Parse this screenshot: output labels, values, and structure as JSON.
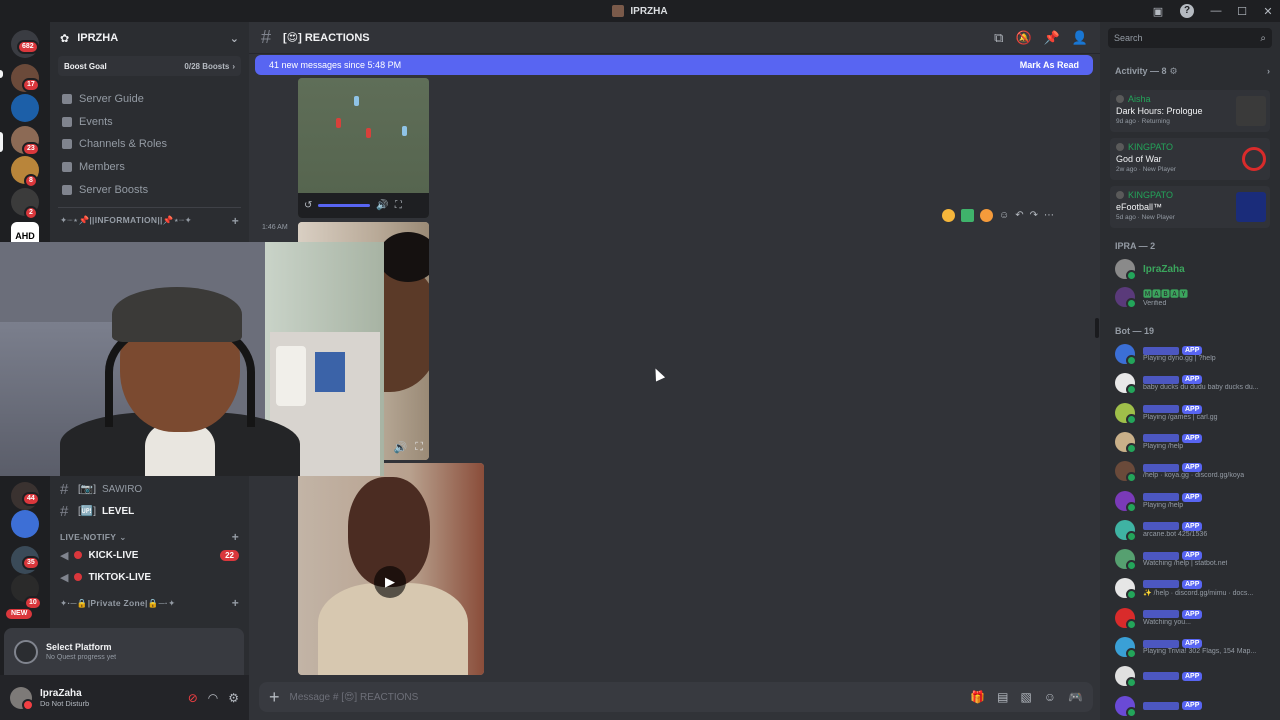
{
  "window": {
    "title": "IPRZHA"
  },
  "rail": {
    "home_badge": "682",
    "badges": [
      "17",
      "23",
      "8",
      "2",
      "44",
      "35",
      "10"
    ],
    "new_label": "NEW",
    "ahd_label": "AHD"
  },
  "server": {
    "name": "IPRZHA",
    "boost_goal": "Boost Goal",
    "boost_count": "0/28 Boosts",
    "nav": [
      "Server Guide",
      "Events",
      "Channels & Roles",
      "Members",
      "Server Boosts"
    ],
    "info_category": "✦┈⋆📌||INFORMATION||📌⋆┈✦",
    "channels_upper": [
      {
        "tag": "[📷]",
        "name": "SAWIRO"
      },
      {
        "tag": "[🆙]",
        "name": "LEVEL"
      }
    ],
    "live_category": "LIVE-NOTIFY",
    "live_channels": [
      {
        "name": "KICK-LIVE",
        "badge": "22"
      },
      {
        "name": "TIKTOK-LIVE",
        "badge": ""
      }
    ],
    "private_category": "✦·─🔒|Private Zone|🔒─·✦"
  },
  "quest": {
    "title": "Select Platform",
    "subtitle": "No Quest progress yet"
  },
  "user": {
    "name": "IpraZaha",
    "status": "Do Not Disturb"
  },
  "chat": {
    "channel_name": "[😍] REACTIONS",
    "new_messages": "41 new messages since 5:48 PM",
    "mark_read": "Mark As Read",
    "timestamp": "1:46 AM",
    "composer_placeholder": "Message # [😍] REACTIONS"
  },
  "members": {
    "search_placeholder": "Search",
    "activity_header": "Activity — 8",
    "activities": [
      {
        "user": "Aisha",
        "game": "Dark Hours: Prologue",
        "meta": "9d ago · Returning"
      },
      {
        "user": "KINGPATO",
        "game": "God of War",
        "meta": "2w ago · New Player"
      },
      {
        "user": "KINGPATO",
        "game": "eFootball™",
        "meta": "5d ago · New Player"
      }
    ],
    "ipra_header": "IPRA — 2",
    "ipra": [
      {
        "name": "IpraZaha",
        "sub": ""
      },
      {
        "name": "🅼🅰🅱🅰🆈",
        "sub": "Verified"
      }
    ],
    "bot_header": "Bot — 19",
    "app_label": "APP",
    "bots": [
      "Playing dyno.gg | ?help",
      "baby ducks du dudu baby ducks du...",
      "Playing /games | carl.gg",
      "Playing /help",
      "/help · koya.gg · discord.gg/koya",
      "Playing /help",
      "arcane.bot 425/1536",
      "Watching /help | statbot.net",
      "✨ /help · discord.gg/mimu · docs...",
      "Watching you...",
      "Playing Trivia! 302 Flags, 154 Map...",
      "",
      ""
    ]
  }
}
